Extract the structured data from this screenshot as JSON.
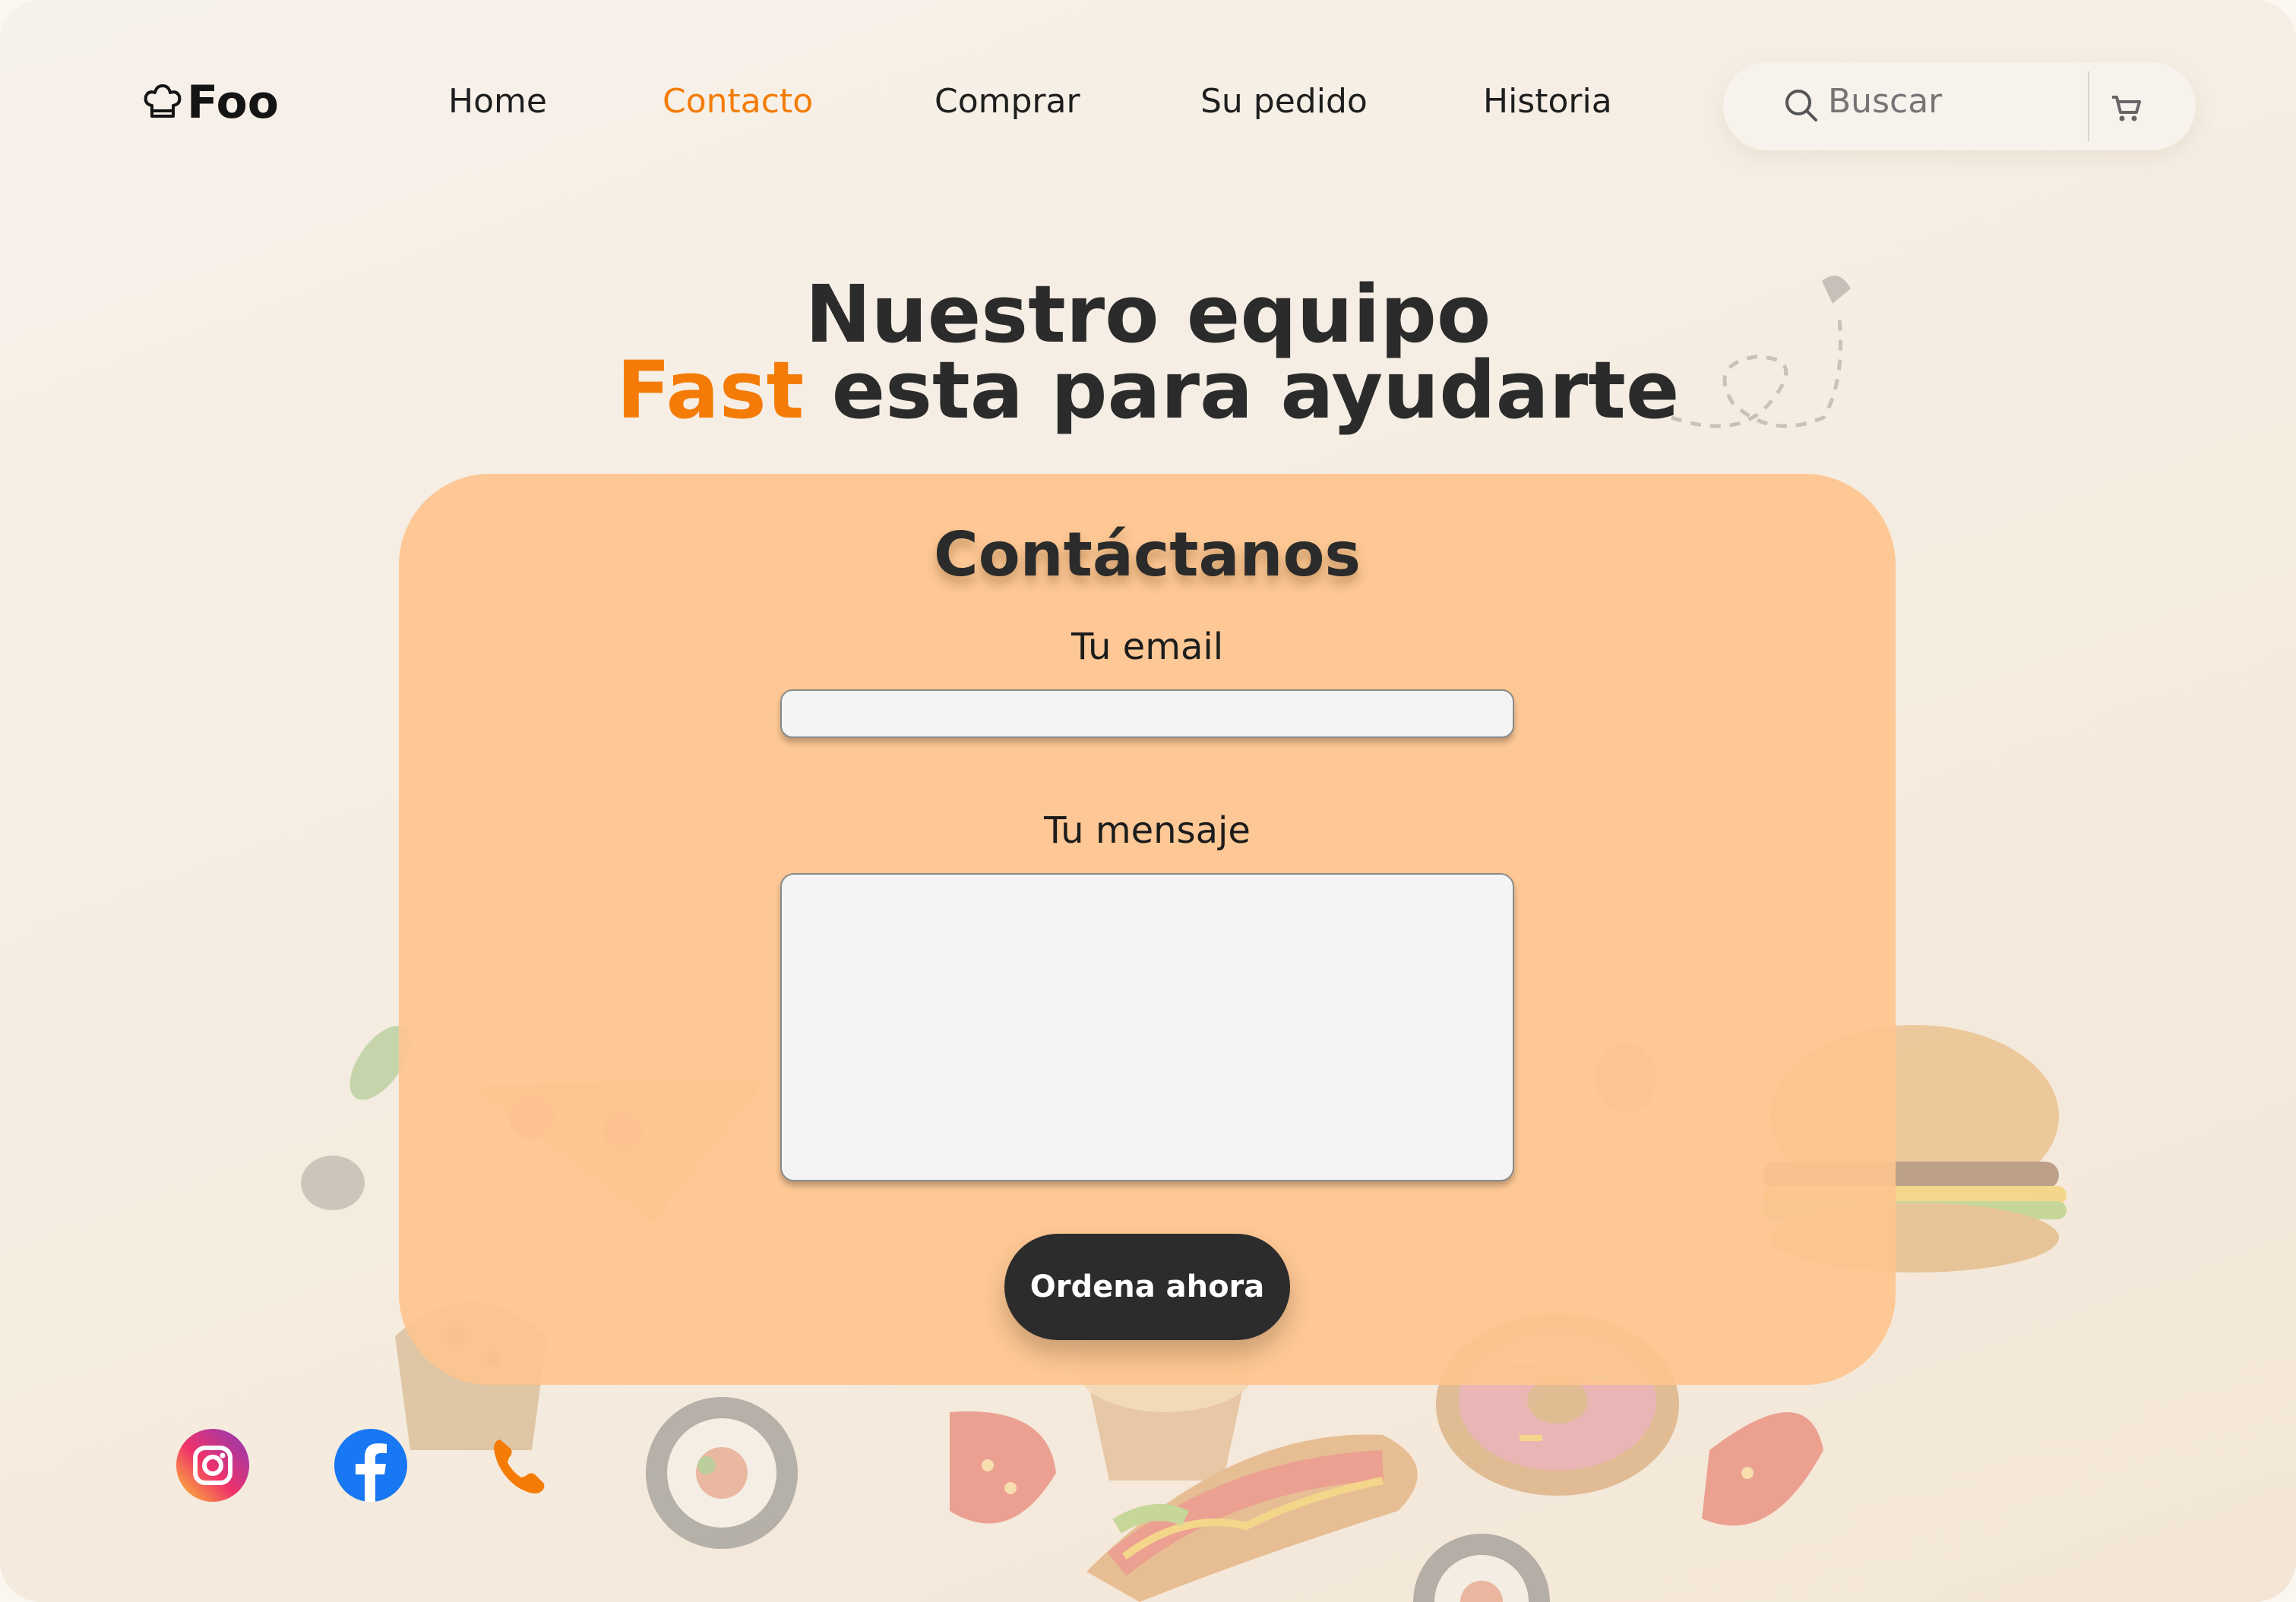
{
  "header": {
    "logo_text": "Foo",
    "logo_icon": "chef-hat-icon",
    "nav": [
      {
        "label": "Home",
        "active": false
      },
      {
        "label": "Contacto",
        "active": true
      },
      {
        "label": "Comprar",
        "active": false
      },
      {
        "label": "Su pedido",
        "active": false
      },
      {
        "label": "Historia",
        "active": false
      }
    ],
    "search": {
      "placeholder": "Buscar",
      "icon": "search-icon"
    },
    "cart_icon": "cart-icon"
  },
  "hero": {
    "line1": "Nuestro equipo",
    "line2_accent": "Fast",
    "line2_rest": " esta para ayudarte"
  },
  "contact": {
    "title": "Contáctanos",
    "email_label": "Tu email",
    "email_value": "",
    "message_label": "Tu mensaje",
    "message_value": "",
    "submit_label": "Ordena ahora"
  },
  "social": [
    {
      "name": "instagram-icon"
    },
    {
      "name": "facebook-icon"
    },
    {
      "name": "phone-icon"
    }
  ],
  "colors": {
    "accent": "#f47c06",
    "card": "#fdc58f",
    "button": "#2c2c2c",
    "text": "#2b2b2b",
    "background": "#f6f1ea"
  }
}
